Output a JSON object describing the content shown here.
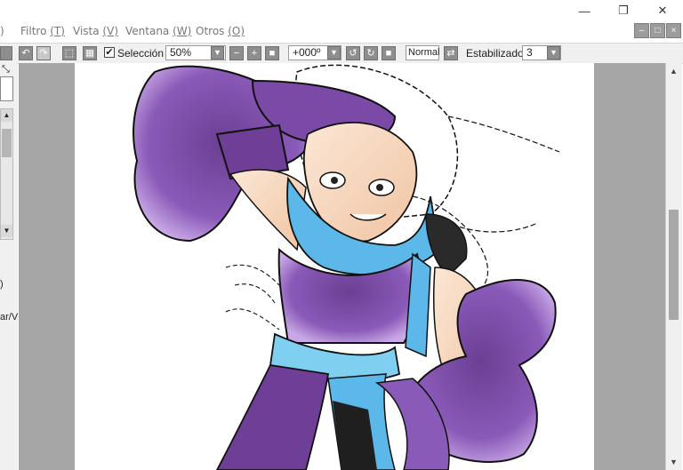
{
  "window": {
    "minimize_glyph": "—",
    "restore_glyph": "❐",
    "close_glyph": "✕"
  },
  "menu": {
    "items": [
      {
        "label": ")",
        "shortcut": ""
      },
      {
        "label": "Filtro",
        "shortcut": "(T)"
      },
      {
        "label": "Vista",
        "shortcut": "(V)"
      },
      {
        "label": "Ventana",
        "shortcut": "(W)"
      },
      {
        "label": "Otros",
        "shortcut": "(O)"
      }
    ]
  },
  "toolbar": {
    "selection_label": "Selección",
    "selection_checked": true,
    "zoom_value": "50%",
    "rotation_value": "+000º",
    "blend_mode": "Normal",
    "stabilizer_label": "Estabilizador",
    "stabilizer_value": "3"
  },
  "left_panel": {
    "fragment_1": ")",
    "fragment_2": "ar/V"
  },
  "colors": {
    "canvas_bg": "#a6a6a6",
    "paper": "#ffffff",
    "purple": "#8a5ab8",
    "blue": "#5cb8e8",
    "skin": "#f6d2b4",
    "accent_window": "#e8eaf6"
  },
  "icons": [
    "minimize-icon",
    "restore-icon",
    "close-icon",
    "undo-icon",
    "redo-icon",
    "zoom-out-icon",
    "zoom-in-icon",
    "zoom-reset-icon",
    "rotate-left-icon",
    "rotate-right-icon",
    "rotate-reset-icon",
    "flip-icon",
    "dropdown-icon"
  ]
}
